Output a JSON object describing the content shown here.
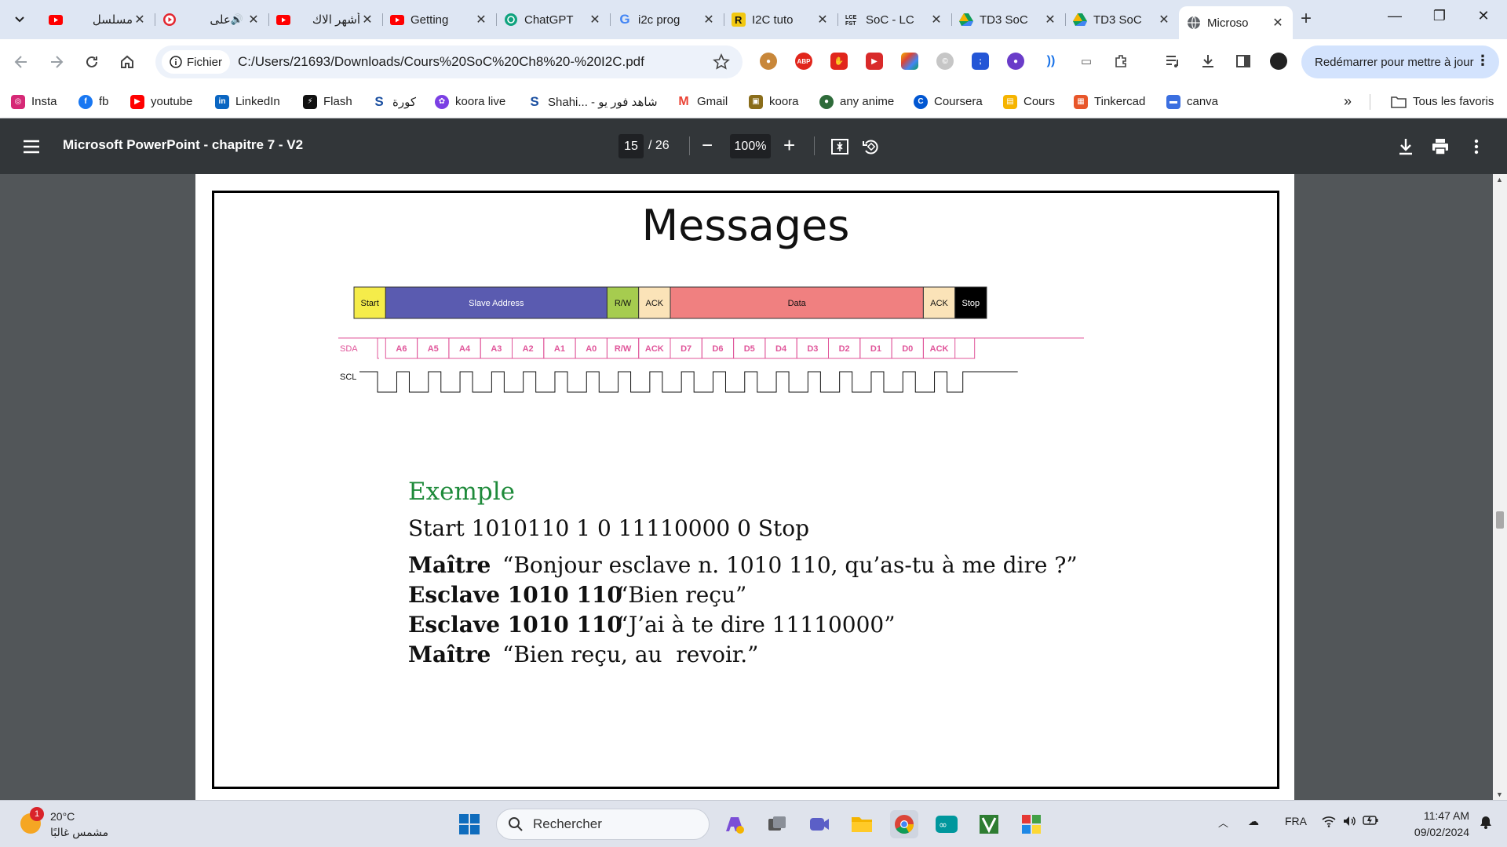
{
  "browser": {
    "tabs": [
      {
        "title": "مسلسل",
        "favicon": "youtube-icon",
        "color": "#ff0000",
        "active": false
      },
      {
        "title": "على",
        "favicon": "record-icon",
        "color": "#e3262f",
        "active": false,
        "audio": true
      },
      {
        "title": "أشهر الاك",
        "favicon": "youtube-icon",
        "color": "#ff0000",
        "active": false
      },
      {
        "title": "Getting",
        "favicon": "youtube-icon",
        "color": "#ff0000",
        "active": false
      },
      {
        "title": "ChatGPT",
        "favicon": "chatgpt-icon",
        "color": "#10a37f",
        "active": false
      },
      {
        "title": "i2c prog",
        "favicon": "google-icon",
        "color": "#4285f4",
        "active": false
      },
      {
        "title": "I2C tuto",
        "favicon": "r-logo-icon",
        "color": "#f2c811",
        "active": false
      },
      {
        "title": "SoC - LC",
        "favicon": "lce-fst-icon",
        "color": "#111111",
        "active": false
      },
      {
        "title": "TD3 SoC",
        "favicon": "google-drive-icon",
        "color": "#0f9d58",
        "active": false
      },
      {
        "title": "TD3 SoC",
        "favicon": "google-drive-icon",
        "color": "#0f9d58",
        "active": false
      },
      {
        "title": "Microso",
        "favicon": "globe-icon",
        "color": "#5f6368",
        "active": true
      }
    ],
    "omnibox": {
      "chip": "Fichier",
      "url": "C:/Users/21693/Downloads/Cours%20SoC%20Ch8%20-%20I2C.pdf"
    },
    "restart_button": "Redémarrer pour mettre à jour",
    "bookmarks": [
      {
        "label": "Insta",
        "icon": "instagram-icon",
        "color": "#d62976"
      },
      {
        "label": "fb",
        "icon": "facebook-icon",
        "color": "#1877f2"
      },
      {
        "label": "youtube",
        "icon": "youtube-icon",
        "color": "#ff0000"
      },
      {
        "label": "LinkedIn",
        "icon": "linkedin-icon",
        "color": "#0a66c2"
      },
      {
        "label": "Flash",
        "icon": "flash-icon",
        "color": "#111111"
      },
      {
        "label": "كورة",
        "icon": "s-logo-icon",
        "color": "#1a4fa0"
      },
      {
        "label": "koora live",
        "icon": "koora-live-icon",
        "color": "#7b3fe4"
      },
      {
        "label": "Shahi... - شاهد فور يو",
        "icon": "s-logo-icon",
        "color": "#1a4fa0"
      },
      {
        "label": "Gmail",
        "icon": "gmail-icon",
        "color": "#ea4335"
      },
      {
        "label": "koora",
        "icon": "koora-icon",
        "color": "#8a6d1a"
      },
      {
        "label": "any anime",
        "icon": "anime-icon",
        "color": "#2e6b3a"
      },
      {
        "label": "Coursera",
        "icon": "coursera-icon",
        "color": "#0056d2"
      },
      {
        "label": "Cours",
        "icon": "classroom-icon",
        "color": "#f6b400"
      },
      {
        "label": "Tinkercad",
        "icon": "tinkercad-icon",
        "color": "#e8562a"
      },
      {
        "label": "canva",
        "icon": "canva-icon",
        "color": "#3b6fe0"
      }
    ],
    "all_bookmarks": "Tous les favoris"
  },
  "pdf": {
    "title": "Microsoft PowerPoint - chapitre 7 - V2",
    "page_current": "15",
    "page_total": "/ 26",
    "zoom": "100%"
  },
  "slide": {
    "title": "Messages",
    "frame": {
      "segments": [
        {
          "label": "Start",
          "color": "#f5ec4a",
          "text": "#111111"
        },
        {
          "label": "Slave Address",
          "color": "#5a5bb0",
          "text": "#ffffff"
        },
        {
          "label": "R/W",
          "color": "#a6cc4f",
          "text": "#111111"
        },
        {
          "label": "ACK",
          "color": "#fbe3b8",
          "text": "#111111"
        },
        {
          "label": "Data",
          "color": "#f08080",
          "text": "#111111"
        },
        {
          "label": "ACK",
          "color": "#fbe3b8",
          "text": "#111111"
        },
        {
          "label": "Stop",
          "color": "#000000",
          "text": "#ffffff"
        }
      ]
    },
    "sda_label": "SDA",
    "scl_label": "SCL",
    "sda_bits": [
      "A6",
      "A5",
      "A4",
      "A3",
      "A2",
      "A1",
      "A0",
      "R/W",
      "ACK",
      "D7",
      "D6",
      "D5",
      "D4",
      "D3",
      "D2",
      "D1",
      "D0",
      "ACK"
    ],
    "sda_color": "#e0559a",
    "example": {
      "heading": "Exemple",
      "sequence": "Start 1010110 1 0 11110000 0 Stop",
      "dialogue": [
        {
          "speaker": "Maître",
          "text": "“Bonjour esclave n. 1010 110, qu’as-tu à me dire ?”"
        },
        {
          "speaker": "Esclave 1010 110",
          "text": "“Bien reçu”"
        },
        {
          "speaker": "Esclave 1010 110",
          "text": "“J’ai à te dire 11110000”"
        },
        {
          "speaker": "Maître",
          "text": "“Bien reçu, au  revoir.”"
        }
      ]
    }
  },
  "taskbar": {
    "weather_temp": "20°C",
    "weather_desc": "مشمس غالبًا",
    "weather_badge": "1",
    "search_placeholder": "Rechercher",
    "language": "FRA",
    "time": "11:47 AM",
    "date": "09/02/2024"
  }
}
